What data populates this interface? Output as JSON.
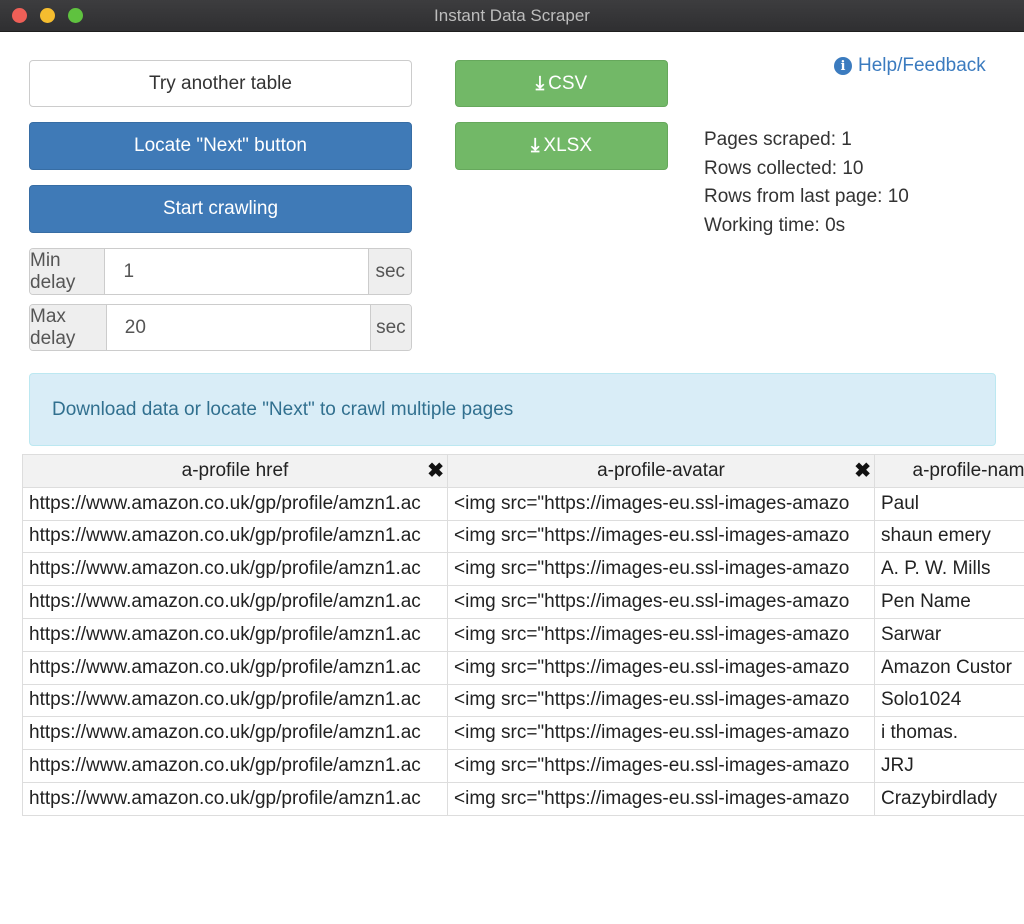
{
  "window": {
    "title": "Instant Data Scraper"
  },
  "buttons": {
    "try_another": "Try another table",
    "locate_next": "Locate \"Next\" button",
    "start_crawling": "Start crawling",
    "csv": "CSV",
    "xlsx": "XLSX"
  },
  "delays": {
    "min_label": "Min delay",
    "min_value": "1",
    "max_label": "Max delay",
    "max_value": "20",
    "unit": "sec"
  },
  "help": {
    "label": "Help/Feedback",
    "icon": "info-circle-icon"
  },
  "stats": {
    "pages_scraped": "Pages scraped: 1",
    "rows_collected": "Rows collected: 10",
    "rows_last_page": "Rows from last page: 10",
    "working_time": "Working time: 0s"
  },
  "alert": "Download data or locate \"Next\" to crawl multiple pages",
  "colors": {
    "primary": "#3f7ab7",
    "success": "#72b867",
    "info_bg": "#d9edf7"
  },
  "table": {
    "columns": [
      "a-profile href",
      "a-profile-avatar",
      "a-profile-nam"
    ],
    "rows": [
      [
        "https://www.amazon.co.uk/gp/profile/amzn1.ac",
        "<img src=\"https://images-eu.ssl-images-amazo",
        "Paul"
      ],
      [
        "https://www.amazon.co.uk/gp/profile/amzn1.ac",
        "<img src=\"https://images-eu.ssl-images-amazo",
        "shaun emery"
      ],
      [
        "https://www.amazon.co.uk/gp/profile/amzn1.ac",
        "<img src=\"https://images-eu.ssl-images-amazo",
        "A. P. W. Mills"
      ],
      [
        "https://www.amazon.co.uk/gp/profile/amzn1.ac",
        "<img src=\"https://images-eu.ssl-images-amazo",
        "Pen Name"
      ],
      [
        "https://www.amazon.co.uk/gp/profile/amzn1.ac",
        "<img src=\"https://images-eu.ssl-images-amazo",
        "Sarwar"
      ],
      [
        "https://www.amazon.co.uk/gp/profile/amzn1.ac",
        "<img src=\"https://images-eu.ssl-images-amazo",
        "Amazon Custor"
      ],
      [
        "https://www.amazon.co.uk/gp/profile/amzn1.ac",
        "<img src=\"https://images-eu.ssl-images-amazo",
        "Solo1024"
      ],
      [
        "https://www.amazon.co.uk/gp/profile/amzn1.ac",
        "<img src=\"https://images-eu.ssl-images-amazo",
        "i thomas."
      ],
      [
        "https://www.amazon.co.uk/gp/profile/amzn1.ac",
        "<img src=\"https://images-eu.ssl-images-amazo",
        "JRJ"
      ],
      [
        "https://www.amazon.co.uk/gp/profile/amzn1.ac",
        "<img src=\"https://images-eu.ssl-images-amazo",
        "Crazybirdlady"
      ]
    ]
  }
}
